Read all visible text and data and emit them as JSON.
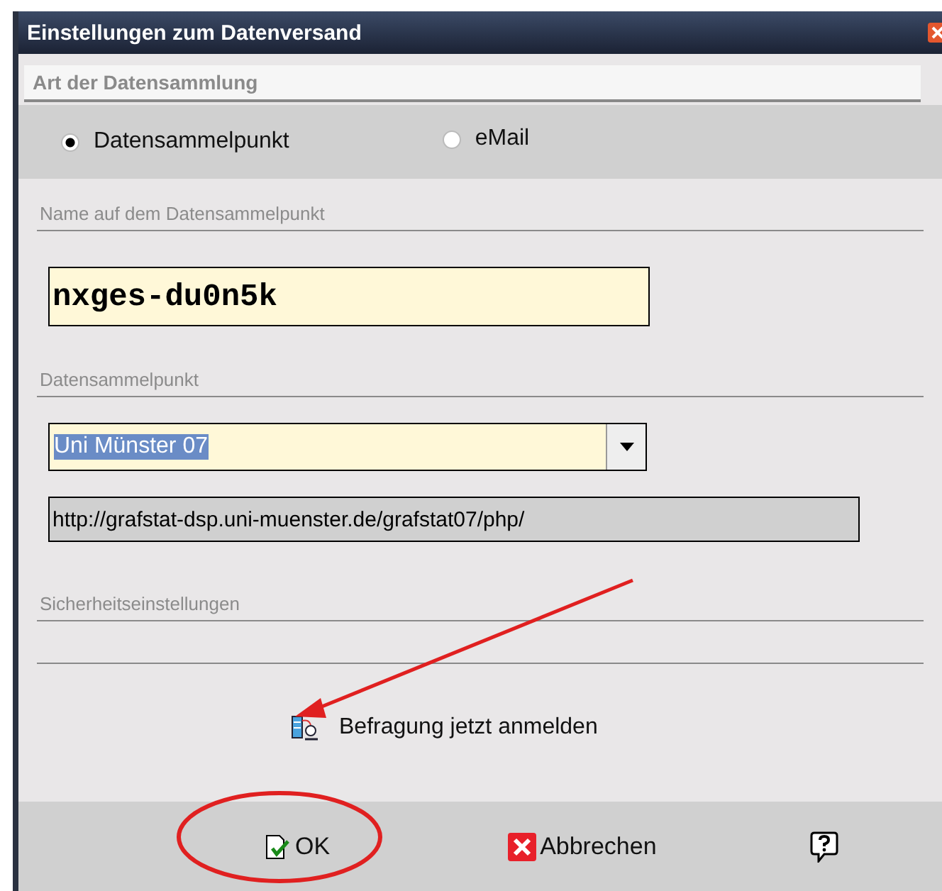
{
  "window": {
    "title": "Einstellungen zum Datenversand"
  },
  "section_header": "Art der Datensammlung",
  "radios": [
    {
      "label": "Datensammelpunkt",
      "selected": true
    },
    {
      "label": "eMail",
      "selected": false
    }
  ],
  "name_group": {
    "label": "Name auf dem Datensammelpunkt",
    "value": "nxges-du0n5k"
  },
  "collection_point_group": {
    "label": "Datensammelpunkt",
    "select_value": "Uni Münster 07",
    "url": "http://grafstat-dsp.uni-muenster.de/grafstat07/php/"
  },
  "security_group": {
    "label": "Sicherheitseinstellungen"
  },
  "register_link": "Befragung jetzt anmelden",
  "buttons": [
    {
      "kind": "ok",
      "label": "OK"
    },
    {
      "kind": "cancel",
      "label": "Abbrechen"
    },
    {
      "kind": "help"
    }
  ]
}
